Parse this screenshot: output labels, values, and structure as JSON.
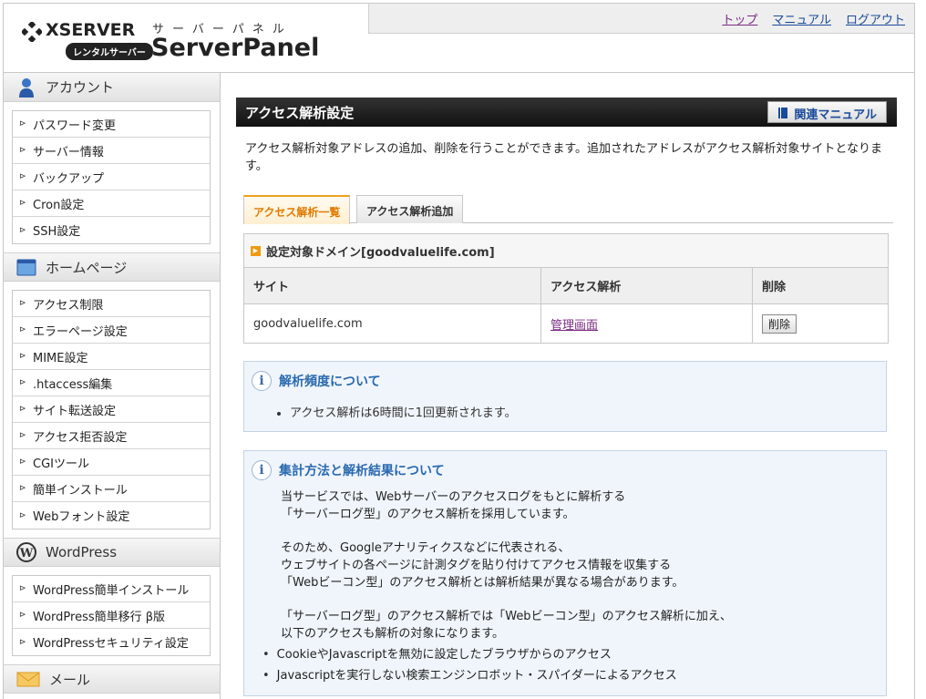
{
  "header": {
    "logo_name": "XSERVER",
    "logo_badge": "レンタルサーバー",
    "panel_kana": "サーバーパネル",
    "panel_title": "ServerPanel",
    "nav": [
      "トップ",
      "マニュアル",
      "ログアウト"
    ]
  },
  "sidebar": {
    "sections": [
      {
        "title": "アカウント",
        "icon": "person-icon",
        "items": [
          "パスワード変更",
          "サーバー情報",
          "バックアップ",
          "Cron設定",
          "SSH設定"
        ]
      },
      {
        "title": "ホームページ",
        "icon": "webpage-icon",
        "items": [
          "アクセス制限",
          "エラーページ設定",
          "MIME設定",
          ".htaccess編集",
          "サイト転送設定",
          "アクセス拒否設定",
          "CGIツール",
          "簡単インストール",
          "Webフォント設定"
        ]
      },
      {
        "title": "WordPress",
        "icon": "wordpress-icon",
        "items": [
          "WordPress簡単インストール",
          "WordPress簡単移行 β版",
          "WordPressセキュリティ設定"
        ]
      },
      {
        "title": "メール",
        "icon": "mail-icon",
        "items": []
      }
    ]
  },
  "main": {
    "page_title": "アクセス解析設定",
    "manual_button": "関連マニュアル",
    "description": "アクセス解析対象アドレスの追加、削除を行うことができます。追加されたアドレスがアクセス解析対象サイトとなります。",
    "tabs": [
      "アクセス解析一覧",
      "アクセス解析追加"
    ],
    "domain_caption": "設定対象ドメイン[goodvaluelife.com]",
    "table": {
      "headers": [
        "サイト",
        "アクセス解析",
        "削除"
      ],
      "rows": [
        {
          "site": "goodvaluelife.com",
          "analysis_link": "管理画面",
          "delete_label": "削除"
        }
      ]
    },
    "info1": {
      "title": "解析頻度について",
      "bullet": "アクセス解析は6時間に1回更新されます。"
    },
    "info2": {
      "title": "集計方法と解析結果について",
      "p1_l1": "当サービスでは、Webサーバーのアクセスログをもとに解析する",
      "p1_l2": "「サーバーログ型」のアクセス解析を採用しています。",
      "p2_l1": "そのため、Googleアナリティクスなどに代表される、",
      "p2_l2": "ウェブサイトの各ページに計測タグを貼り付けてアクセス情報を収集する",
      "p2_l3": "「Webビーコン型」のアクセス解析とは解析結果が異なる場合があります。",
      "p3_l1": "「サーバーログ型」のアクセス解析では「Webビーコン型」のアクセス解析に加え、",
      "p3_l2": "以下のアクセスも解析の対象になります。",
      "bullets": [
        "CookieやJavascriptを無効に設定したブラウザからのアクセス",
        "Javascriptを実行しない検索エンジンロボット・スパイダーによるアクセス"
      ]
    }
  }
}
